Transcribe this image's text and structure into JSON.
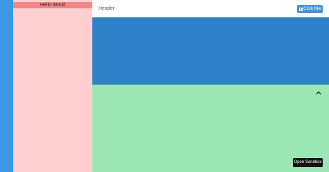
{
  "sidebar": {
    "banner_text": "Hello World"
  },
  "header": {
    "title": "Header",
    "button_label": "Click Me",
    "button_icon": "calendar-icon"
  },
  "panels": {
    "collapse_icon": "chevron-up-icon"
  },
  "sandbox": {
    "button_label": "Open Sandbox"
  },
  "colors": {
    "left_rail": "#3d98e3",
    "sidebar": "#ffcfcf",
    "sidebar_banner": "#f58585",
    "header_button": "#4a94d6",
    "blue_panel": "#2f82c9",
    "green_panel": "#9be6b4",
    "sandbox_button": "#111111"
  }
}
